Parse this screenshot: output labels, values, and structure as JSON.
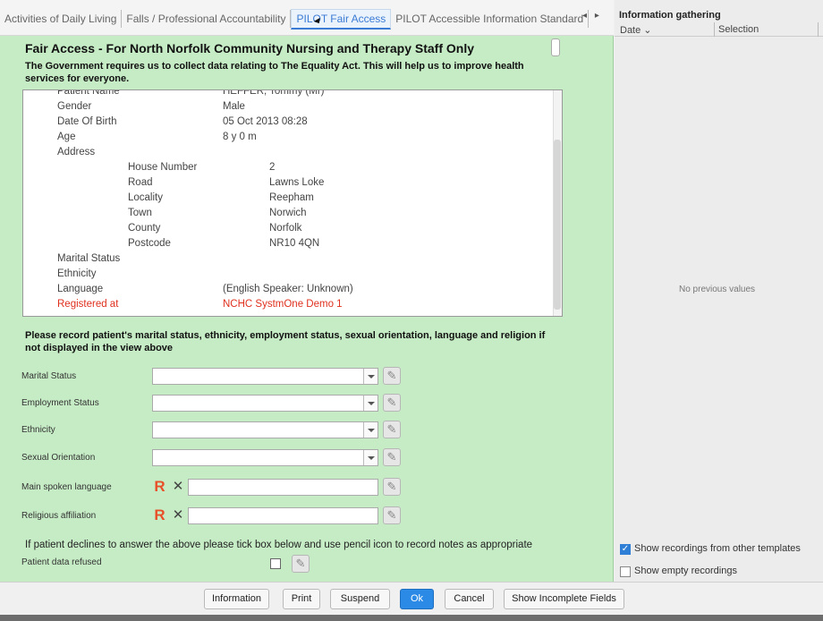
{
  "tabs": [
    {
      "label": "Activities of Daily Living"
    },
    {
      "label": "Falls / Professional Accountability"
    },
    {
      "label": "PILOT Fair Access"
    },
    {
      "label": "PILOT Accessible Information Standard"
    }
  ],
  "tab_scroll": {
    "left": "◂",
    "right": "▸"
  },
  "form": {
    "title": "Fair Access -  For North Norfolk Community Nursing and Therapy Staff Only",
    "intro": "The Government requires us to collect data relating to The Equality Act. This will help us to improve health services for everyone.",
    "details": {
      "patient_name_label": "Patient Name",
      "patient_name_value": "HEFFER, Tommy (Mr)",
      "gender_label": "Gender",
      "gender_value": "Male",
      "dob_label": "Date Of Birth",
      "dob_value": "05 Oct 2013 08:28",
      "age_label": "Age",
      "age_value": "8 y  0 m",
      "address_label": "Address",
      "house_label": "House Number",
      "house_value": "2",
      "road_label": "Road",
      "road_value": "Lawns Loke",
      "locality_label": "Locality",
      "locality_value": "Reepham",
      "town_label": "Town",
      "town_value": "Norwich",
      "county_label": "County",
      "county_value": "Norfolk",
      "postcode_label": "Postcode",
      "postcode_value": "NR10 4QN",
      "marital_label": "Marital Status",
      "ethnicity_label": "Ethnicity",
      "language_label": "Language",
      "language_value": "(English Speaker: Unknown)",
      "registered_label": "Registered at",
      "registered_value": "NCHC SystmOne Demo 1"
    },
    "record_text": "Please record patient's marital status, ethnicity, employment status, sexual orientation, language and religion if not displayed in the view above",
    "fields": {
      "marital": "Marital Status",
      "employment": "Employment Status",
      "ethnicity": "Ethnicity",
      "orientation": "Sexual Orientation",
      "language": "Main spoken language",
      "religion": "Religious affiliation"
    },
    "r_glyph": "R",
    "x_glyph": "✕",
    "pencil_glyph": "✎",
    "declines_text": "If patient declines to answer the above please tick box below and use pencil icon to record notes as appropriate",
    "refused_label": "Patient data refused",
    "refused_checked": false
  },
  "right_panel": {
    "title": "Information gathering",
    "col_date": "Date ⌄",
    "col_selection": "Selection",
    "empty_text": "No previous values",
    "show_other_templates": "Show recordings from other templates",
    "show_other_checked": true,
    "show_empty": "Show empty recordings",
    "show_empty_checked": false
  },
  "buttons": {
    "information": "Information",
    "print": "Print",
    "suspend": "Suspend",
    "ok": "Ok",
    "cancel": "Cancel",
    "show_incomplete": "Show Incomplete Fields"
  },
  "colors": {
    "form_bg": "#c6ecc5",
    "accent": "#2b8ae6",
    "warning_red": "#e0301e"
  }
}
